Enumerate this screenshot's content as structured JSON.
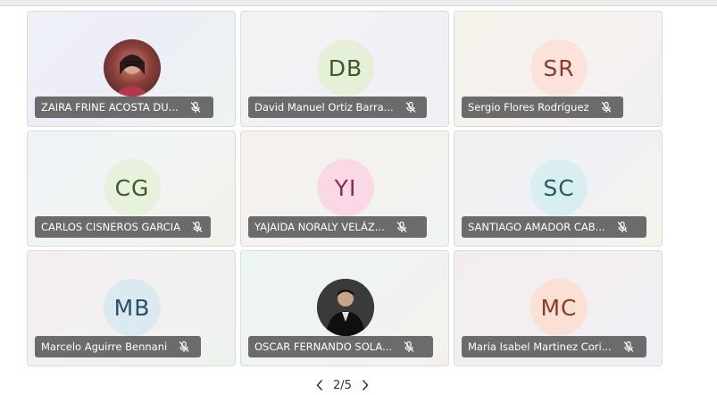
{
  "pagination": {
    "current": "2/5"
  },
  "tiles": [
    {
      "name": "ZAIRA FRINE ACOSTA DU...",
      "initials": "",
      "avatar_type": "photo",
      "avatar_bg": "#8b3f3a",
      "avatar_fg": "#ffffff",
      "mic_icon": "mic-muted-icon"
    },
    {
      "name": "David Manuel Ortiz Barra...",
      "initials": "DB",
      "avatar_type": "initials",
      "avatar_bg": "#e6f0d8",
      "avatar_fg": "#3d5a26",
      "mic_icon": "mic-muted-icon"
    },
    {
      "name": "Sergio Flores Rodríguez",
      "initials": "SR",
      "avatar_type": "initials",
      "avatar_bg": "#fbe3db",
      "avatar_fg": "#8c3a26",
      "mic_icon": "mic-muted-icon"
    },
    {
      "name": "CARLOS CISNEROS GARCIA",
      "initials": "CG",
      "avatar_type": "initials",
      "avatar_bg": "#e8f1db",
      "avatar_fg": "#3d5a26",
      "mic_icon": "mic-muted-icon"
    },
    {
      "name": "YAJAIDA NORALY VELÁZ...",
      "initials": "YI",
      "avatar_type": "initials",
      "avatar_bg": "#fbd8e6",
      "avatar_fg": "#8c2750",
      "mic_icon": "mic-muted-icon"
    },
    {
      "name": "SANTIAGO AMADOR CAB...",
      "initials": "SC",
      "avatar_type": "initials",
      "avatar_bg": "#d9eef1",
      "avatar_fg": "#275a62",
      "mic_icon": "mic-muted-icon"
    },
    {
      "name": "Marcelo Aguirre Bennani",
      "initials": "MB",
      "avatar_type": "initials",
      "avatar_bg": "#dbe9f2",
      "avatar_fg": "#2a4f66",
      "mic_icon": "mic-muted-icon"
    },
    {
      "name": "OSCAR FERNANDO SOLA...",
      "initials": "",
      "avatar_type": "photo",
      "avatar_bg": "#2a2a2a",
      "avatar_fg": "#ffffff",
      "mic_icon": "mic-muted-icon"
    },
    {
      "name": "Maria Isabel Martinez Cori...",
      "initials": "MC",
      "avatar_type": "initials",
      "avatar_bg": "#fbe0d6",
      "avatar_fg": "#8c3a26",
      "mic_icon": "mic-muted-icon"
    }
  ]
}
